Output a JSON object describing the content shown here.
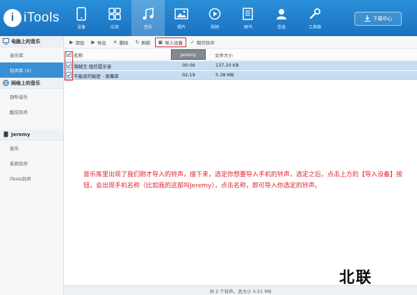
{
  "app": {
    "logo_text": "iTools"
  },
  "nav": [
    {
      "label": "设备",
      "icon": "phone-icon"
    },
    {
      "label": "应用",
      "icon": "apps-icon"
    },
    {
      "label": "音乐",
      "icon": "music-icon",
      "active": true
    },
    {
      "label": "照片",
      "icon": "photo-icon"
    },
    {
      "label": "视频",
      "icon": "video-icon"
    },
    {
      "label": "图书",
      "icon": "book-icon"
    },
    {
      "label": "信息",
      "icon": "user-icon"
    },
    {
      "label": "工具箱",
      "icon": "wrench-icon"
    }
  ],
  "download_label": "下载中心",
  "sidebar": {
    "sections": [
      {
        "title": "电脑上的音乐",
        "items": [
          "音乐库",
          "铃声库 (2)"
        ]
      },
      {
        "title": "网络上的音乐",
        "items": [
          "劲听音乐",
          "酷炫铃声"
        ]
      },
      {
        "title": "Jeremy",
        "items": [
          "音乐",
          "系统铃声",
          "iTools铃声"
        ]
      }
    ]
  },
  "toolbar": {
    "add": "添加",
    "export": "导出",
    "delete": "删除",
    "refresh": "刷新",
    "import_device": "导入设备",
    "make_ringtone": "制作铃声"
  },
  "table": {
    "headers": {
      "name": "名称",
      "duration": "",
      "size": "文件大小"
    },
    "device_tip": "Jeremy",
    "rows": [
      {
        "name": "海贼王-短信提示音",
        "duration": "00:06",
        "size": "137.20 KB"
      },
      {
        "name": "不能说的秘密 - 屏幕库",
        "duration": "02:19",
        "size": "5.38 MB"
      }
    ]
  },
  "note": "音乐库里出现了我们刚才导入的铃声，接下来，选定你想要导入手机的铃声，选定之后，点击上方的【导入设备】按钮，会出现手机名称（比如我的这部叫Jeremy），点击名称，即可导入你选定的铃声。",
  "status": "共 2 个铃声，总大小 5.51 MB",
  "watermark": "北联",
  "colors": {
    "accent": "#1a72c0",
    "selected_row": "#c6def3",
    "highlight": "#d9262b",
    "note": "#e0202a"
  }
}
